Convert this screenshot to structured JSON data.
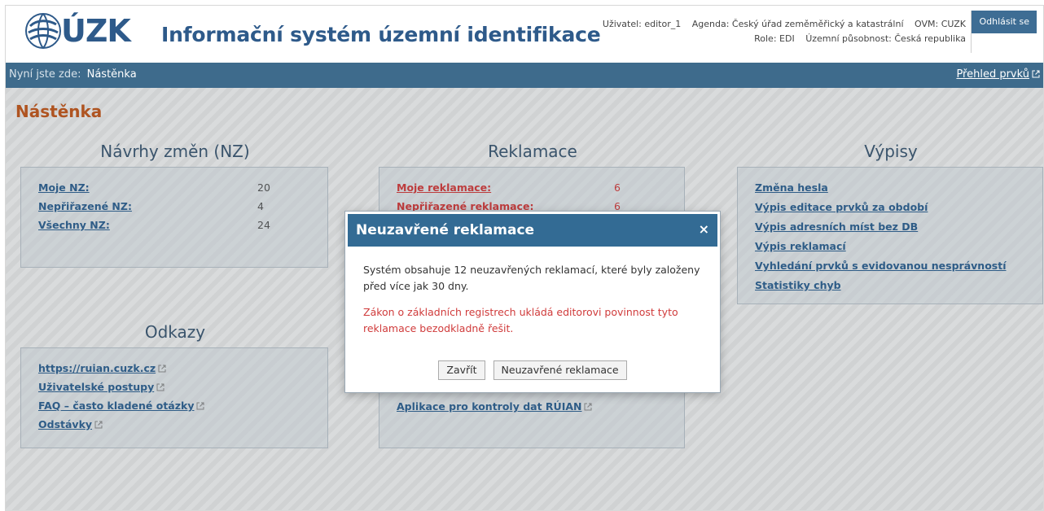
{
  "header": {
    "logo_text": "ÚZK",
    "app_title": "Informační systém územní identifikace",
    "user": "Uživatel: editor_1",
    "agenda": "Agenda: Český úřad zeměměřický a katastrální",
    "ovm": "OVM: CUZK",
    "role": "Role: EDI",
    "territory": "Územní působnost: Česká republika",
    "logout_label": "Odhlásit se"
  },
  "nav": {
    "breadcrumb_prefix": "Nyní jste zde:",
    "breadcrumb_current": "Nástěnka",
    "overview_link": "Přehled prvků"
  },
  "page": {
    "title": "Nástěnka"
  },
  "nz": {
    "title": "Návrhy změn (NZ)",
    "items": [
      {
        "label": "Moje NZ:",
        "count": "20"
      },
      {
        "label": "Nepřiřazené NZ:",
        "count": "4"
      },
      {
        "label": "Všechny NZ:",
        "count": "24"
      }
    ]
  },
  "reklamace": {
    "title": "Reklamace",
    "items": [
      {
        "label": "Moje reklamace:",
        "count": "6"
      },
      {
        "label": "Nepřiřazené reklamace:",
        "count": "6"
      }
    ],
    "app_link": "Aplikace pro kontroly dat RÚIAN"
  },
  "vypisy": {
    "title": "Výpisy",
    "items": [
      "Změna hesla",
      "Výpis editace prvků za období",
      "Výpis adresních míst bez DB",
      "Výpis reklamací",
      "Vyhledání prvků s evidovanou nesprávností",
      "Statistiky chyb"
    ]
  },
  "odkazy": {
    "title": "Odkazy",
    "items": [
      "https://ruian.cuzk.cz",
      "Uživatelské postupy",
      "FAQ – často kladené otázky",
      "Odstávky"
    ]
  },
  "modal": {
    "title": "Neuzavřené reklamace",
    "close_symbol": "×",
    "message": "Systém obsahuje 12 neuzavřených reklamací, které byly založeny před více jak 30 dny.",
    "warning": "Zákon o základních registrech ukládá editorovi povinnost tyto reklamace bezodkladně řešit.",
    "close_button": "Zavřít",
    "open_button": "Neuzavřené reklamace"
  },
  "colors": {
    "brand_blue": "#2e5a8a",
    "nav_bar": "#3e6b8c",
    "title_orange": "#c0561b",
    "warning_red": "#d03b3b",
    "modal_header": "#336b94"
  },
  "icons": {
    "external_link": "external-link-icon",
    "close": "close-icon",
    "logo": "cuzk-logo-icon"
  }
}
